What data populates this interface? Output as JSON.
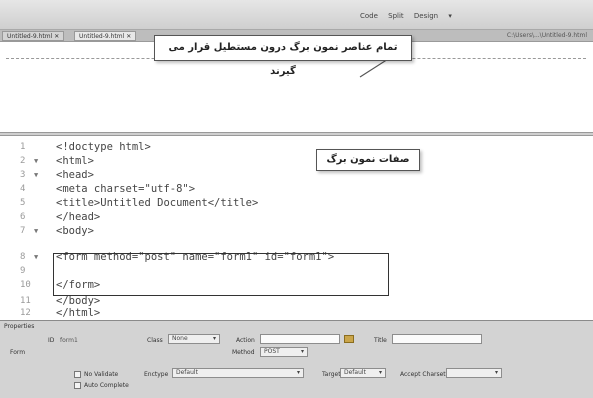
{
  "toolbar": {
    "view_buttons": [
      "Code",
      "Split",
      "Design"
    ]
  },
  "tabs": {
    "left_tab": "Untitled-9.html",
    "active_tab": "Untitled-9.html",
    "path": "C:\\Users\\...\\Untitled-9.html"
  },
  "callouts": {
    "design_view": "تمام عناصر نمون برگ درون مستطیل قرار می گیرند",
    "form_tag": "صفات نمون برگ"
  },
  "code_lines": [
    {
      "num": "1",
      "fold": "",
      "text": "<!doctype html>"
    },
    {
      "num": "2",
      "fold": "▼",
      "text": "<html>"
    },
    {
      "num": "3",
      "fold": "▼",
      "text": "<head>"
    },
    {
      "num": "4",
      "fold": "",
      "text": "<meta charset=\"utf-8\">"
    },
    {
      "num": "5",
      "fold": "",
      "text": "<title>Untitled Document</title>"
    },
    {
      "num": "6",
      "fold": "",
      "text": "</head>"
    },
    {
      "num": "7",
      "fold": "▼",
      "text": "<body>"
    },
    {
      "num": "8",
      "fold": "▼",
      "text": "<form method=\"post\" name=\"form1\" id=\"form1\">"
    },
    {
      "num": "9",
      "fold": "",
      "text": ""
    },
    {
      "num": "10",
      "fold": "",
      "text": "</form>"
    },
    {
      "num": "11",
      "fold": "",
      "text": "</body>"
    },
    {
      "num": "12",
      "fold": "",
      "text": "</html>"
    }
  ],
  "properties": {
    "panel_title": "Properties",
    "form_label": "Form",
    "id_label": "ID",
    "id_value": "form1",
    "class_label": "Class",
    "class_value": "None",
    "action_label": "Action",
    "method_label": "Method",
    "method_value": "POST",
    "title_label": "Title",
    "no_validate": "No Validate",
    "auto_complete": "Auto Complete",
    "enctype_label": "Enctype",
    "enctype_value": "Default",
    "target_label": "Target",
    "target_value": "Default",
    "accept_charset_label": "Accept Charset"
  }
}
